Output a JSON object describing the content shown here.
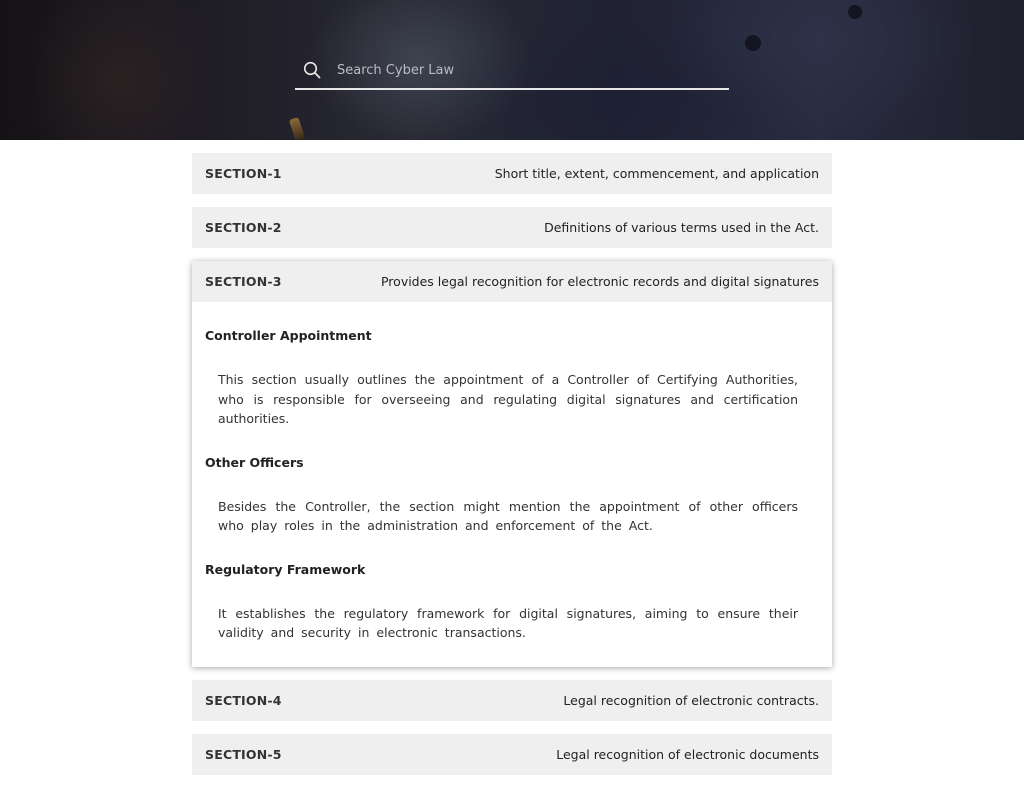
{
  "search": {
    "placeholder": "Search Cyber Law",
    "value": "",
    "icon": "search-icon"
  },
  "colors": {
    "header_bg": "#efefef",
    "underline": "#e6e6e6"
  },
  "sections": [
    {
      "title": "SECTION-1",
      "summary": "Short title, extent, commencement, and application",
      "expanded": false
    },
    {
      "title": "SECTION-2",
      "summary": "Definitions of various terms used in the Act.",
      "expanded": false
    },
    {
      "title": "SECTION-3",
      "summary": "Provides legal recognition for electronic records and digital signatures",
      "expanded": true,
      "content": [
        {
          "heading": "Controller Appointment",
          "text": "This section usually outlines the appointment of a Controller of Certifying Authorities, who is responsible for overseeing and regulating digital signatures and certification authorities."
        },
        {
          "heading": "Other Officers",
          "text": "Besides the Controller, the section might mention the appointment of other officers who play roles in the administration and enforcement of the Act."
        },
        {
          "heading": "Regulatory Framework",
          "text": "It establishes the regulatory framework for digital signatures, aiming to ensure their validity and security in electronic transactions."
        }
      ]
    },
    {
      "title": "SECTION-4",
      "summary": "Legal recognition of electronic contracts.",
      "expanded": false
    },
    {
      "title": "SECTION-5",
      "summary": "Legal recognition of electronic documents",
      "expanded": false
    }
  ]
}
